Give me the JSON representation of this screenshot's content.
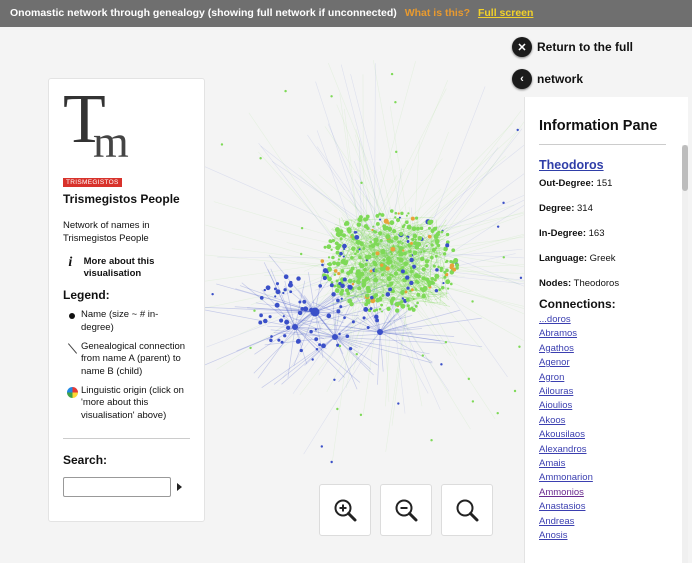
{
  "topbar": {
    "title": "Onomastic network through genealogy (showing full network if unconnected)",
    "what_link": "What is this?",
    "fullscreen_link": "Full screen"
  },
  "nav": {
    "return_label": "Return to the full",
    "network_label": "network"
  },
  "left_panel": {
    "logo_letters": "Tm",
    "logo_badge": "TRISMEGISTOS",
    "title": "Trismegistos People",
    "description": "Network of names in Trismegistos People",
    "more_link": "More about this visualisation",
    "legend_heading": "Legend:",
    "legend_items": [
      "Name (size ~ # in-degree)",
      "Genealogical connection from name A (parent) to name B (child)",
      "Linguistic origin (click on 'more about this visualisation' above)"
    ],
    "search_heading": "Search:",
    "search_value": ""
  },
  "info_pane": {
    "title": "Information Pane",
    "name": "Theodoros",
    "out_degree_label": "Out-Degree:",
    "out_degree": "151",
    "degree_label": "Degree:",
    "degree": "314",
    "in_degree_label": "In-Degree:",
    "in_degree": "163",
    "language_label": "Language:",
    "language": "Greek",
    "nodes_label": "Nodes:",
    "nodes": "Theodoros",
    "connections_heading": "Connections:",
    "connections": [
      "...doros",
      "Abramos",
      "Agathos",
      "Agenor",
      "Agron",
      "Ailouras",
      "Aioulios",
      "Akoos",
      "Akousilaos",
      "Alexandros",
      "Amais",
      "Ammonarion",
      "Ammonios",
      "Anastasios",
      "Andreas",
      "Anosis"
    ]
  },
  "controls": {
    "zoom_in": "zoom-in-icon",
    "zoom_out": "zoom-out-icon",
    "reset": "search-icon"
  },
  "colors": {
    "greek_nodes": "#7ed957",
    "latin_nodes": "#3a4fc8",
    "other_nodes": "#e8a23a",
    "logo_badge": "#d8322b",
    "link": "#3b3fb0"
  }
}
